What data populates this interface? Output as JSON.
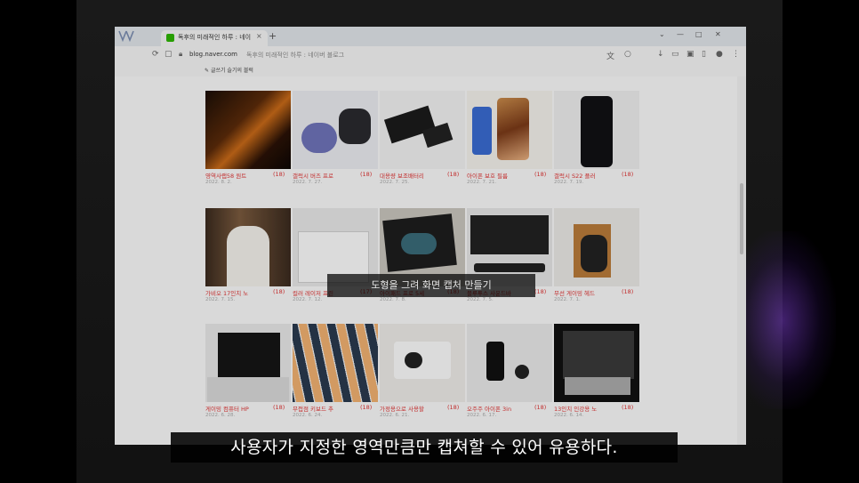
{
  "browser": {
    "tab": {
      "title": "독후의 미래적인 하루 : 네이버",
      "close": "×"
    },
    "new_tab": "+",
    "window_controls": [
      "⌄",
      "—",
      "□",
      "✕"
    ],
    "address": {
      "url": "blog.naver.com",
      "title": "독후의 미래적인 하루 : 네이버 블로그"
    },
    "bookmarks": [
      "글쓰기",
      "슬기의 블럭"
    ]
  },
  "posts": [
    {
      "title": "영역사랩58 원트",
      "count": "(18)",
      "date": "2022. 8. 2."
    },
    {
      "title": "갤럭시 버즈 프로",
      "count": "(18)",
      "date": "2022. 7. 27."
    },
    {
      "title": "대용량 보조배터리",
      "count": "(18)",
      "date": "2022. 7. 25."
    },
    {
      "title": "아이폰 보호 필름",
      "count": "(18)",
      "date": "2022. 7. 21."
    },
    {
      "title": "갤럭시 S22 플러",
      "count": "(18)",
      "date": "2022. 7. 19."
    },
    {
      "title": "가비오 17인치 노",
      "count": "(18)",
      "date": "2022. 7. 15."
    },
    {
      "title": "컬러 레이저 프린",
      "count": "(17)",
      "date": "2022. 7. 12."
    },
    {
      "title": "아이패드 프로 5세",
      "count": "(18)",
      "date": "2022. 7. 8."
    },
    {
      "title": "블루투스 사운드바",
      "count": "(18)",
      "date": "2022. 7. 5."
    },
    {
      "title": "무선 게이밍 헤드",
      "count": "(18)",
      "date": "2022. 7. 1."
    },
    {
      "title": "게이밍 컴퓨터 HP",
      "count": "(18)",
      "date": "2022. 6. 28."
    },
    {
      "title": "무접점 키보드 추",
      "count": "(18)",
      "date": "2022. 6. 24."
    },
    {
      "title": "가정용으로 사용할",
      "count": "(18)",
      "date": "2022. 6. 21."
    },
    {
      "title": "오주주 아이폰 3in",
      "count": "(18)",
      "date": "2022. 6. 17."
    },
    {
      "title": "13인치 인강용 노",
      "count": "(18)",
      "date": "2022. 6. 14."
    }
  ],
  "overlay_label": "도형을 그려 화면 캡처 만들기",
  "subtitle": "사용자가 지정한 영역만큼만 캡쳐할 수 있어 유용하다.",
  "colors": {
    "caption": "#dd3333",
    "tab_bg": "#dfe3e8",
    "page_bg": "#f7f7f7"
  }
}
